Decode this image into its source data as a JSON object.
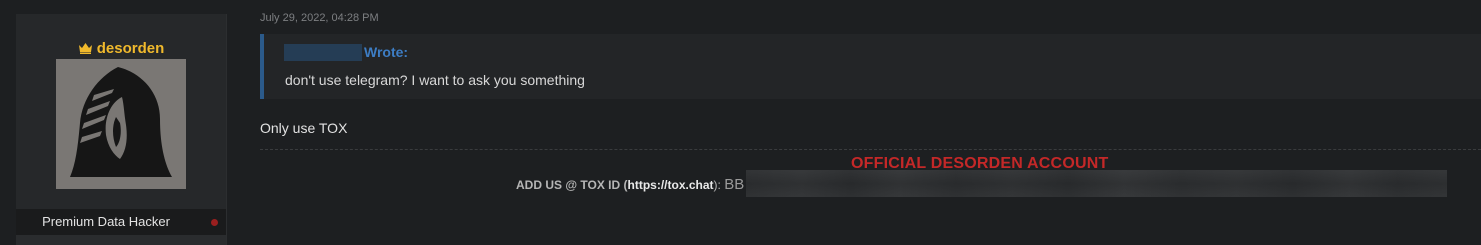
{
  "user": {
    "username": "desorden",
    "title": "Premium Data Hacker",
    "crown_icon": "crown-icon",
    "username_color": "#f0b92c",
    "status_color": "#9a1f1f"
  },
  "post": {
    "date": "July 29, 2022, 04:28 PM",
    "quote": {
      "wrote_label": "Wrote:",
      "text": "don't use telegram? I want to ask you something"
    },
    "message": "Only use TOX"
  },
  "signature": {
    "heading": "OFFICIAL DESORDEN ACCOUNT",
    "heading_color": "#c42828",
    "add_label": "ADD US @ TOX ID (",
    "link_text": "https://tox.chat",
    "after_link": "):",
    "tox_prefix": "BB"
  }
}
